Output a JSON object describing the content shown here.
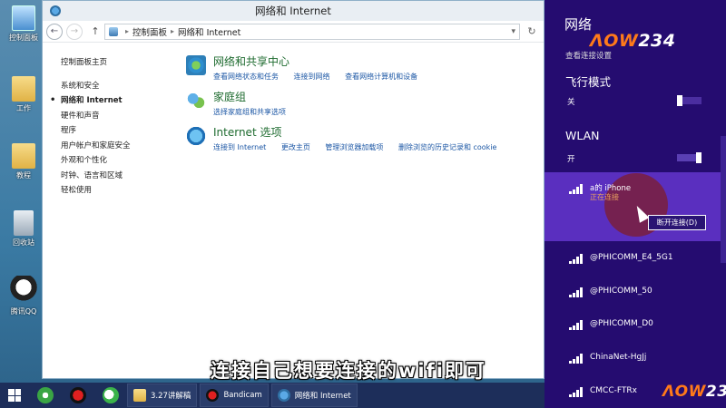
{
  "desktop": {
    "icons": [
      {
        "label": "控制面板"
      },
      {
        "label": "工作"
      },
      {
        "label": "教程"
      },
      {
        "label": "回收站"
      },
      {
        "label": "腾讯QQ"
      }
    ]
  },
  "window": {
    "title": "网络和 Internet",
    "breadcrumb": [
      "控制面板",
      "网络和 Internet"
    ],
    "left_nav": {
      "home": "控制面板主页",
      "items": [
        "系统和安全",
        "网络和 Internet",
        "硬件和声音",
        "程序",
        "用户帐户和家庭安全",
        "外观和个性化",
        "时钟、语言和区域",
        "轻松使用"
      ],
      "active_index": 1
    },
    "categories": [
      {
        "title": "网络和共享中心",
        "links": [
          "查看网络状态和任务",
          "连接到网络",
          "查看网络计算机和设备"
        ]
      },
      {
        "title": "家庭组",
        "links": [
          "选择家庭组和共享选项"
        ]
      },
      {
        "title": "Internet 选项",
        "links": [
          "连接到 Internet",
          "更改主页",
          "管理浏览器加载项",
          "删除浏览的历史记录和 cookie"
        ]
      }
    ]
  },
  "network_panel": {
    "title": "网络",
    "subtitle": "查看连接设置",
    "watermark": {
      "part1": "ΛOW",
      "part2": "234"
    },
    "airplane": {
      "label": "飞行模式",
      "state": "关",
      "on": false
    },
    "wlan": {
      "label": "WLAN",
      "state": "开",
      "on": true
    },
    "connected": {
      "name": "a的 iPhone",
      "status": "正在连接",
      "disconnect_label": "断开连接(D)"
    },
    "networks": [
      "@PHICOMM_E4_5G1",
      "@PHICOMM_50",
      "@PHICOMM_D0",
      "ChinaNet-HgJj",
      "CMCC-FTRx"
    ]
  },
  "subtitle": "连接自己想要连接的wifi即可",
  "taskbar": {
    "items": [
      "3.27讲解稿",
      "Bandicam",
      "网络和 Internet"
    ]
  },
  "colors": {
    "panel_bg": "#250c70",
    "selected_bg": "#5a2fbf",
    "link": "#1c57a5",
    "category_title": "#1e6b2f"
  }
}
